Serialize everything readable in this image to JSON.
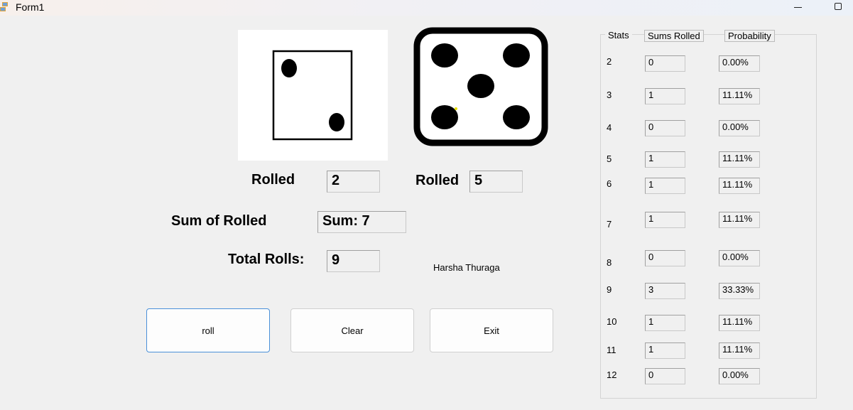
{
  "window": {
    "title": "Form1"
  },
  "dice": {
    "die1_value": 2,
    "die2_value": 5
  },
  "labels": {
    "rolled1": "Rolled",
    "rolled2": "Rolled",
    "sum_label": "Sum of Rolled",
    "total_label": "Total Rolls:",
    "author": "Harsha Thuraga"
  },
  "fields": {
    "die1": "2",
    "die2": "5",
    "sum": "Sum: 7",
    "total": "9"
  },
  "buttons": {
    "roll": "roll",
    "clear": "Clear",
    "exit": "Exit"
  },
  "stats": {
    "header_stats": "Stats",
    "header_sums": "Sums Rolled",
    "header_prob": "Probability",
    "rows": [
      {
        "sum": "2",
        "count": "0",
        "prob": "0.00%"
      },
      {
        "sum": "3",
        "count": "1",
        "prob": "11.11%"
      },
      {
        "sum": "4",
        "count": "0",
        "prob": "0.00%"
      },
      {
        "sum": "5",
        "count": "1",
        "prob": "11.11%"
      },
      {
        "sum": "6",
        "count": "1",
        "prob": "11.11%"
      },
      {
        "sum": "7",
        "count": "1",
        "prob": "11.11%"
      },
      {
        "sum": "8",
        "count": "0",
        "prob": "0.00%"
      },
      {
        "sum": "9",
        "count": "3",
        "prob": "33.33%"
      },
      {
        "sum": "10",
        "count": "1",
        "prob": "11.11%"
      },
      {
        "sum": "11",
        "count": "1",
        "prob": "11.11%"
      },
      {
        "sum": "12",
        "count": "0",
        "prob": "0.00%"
      }
    ]
  }
}
